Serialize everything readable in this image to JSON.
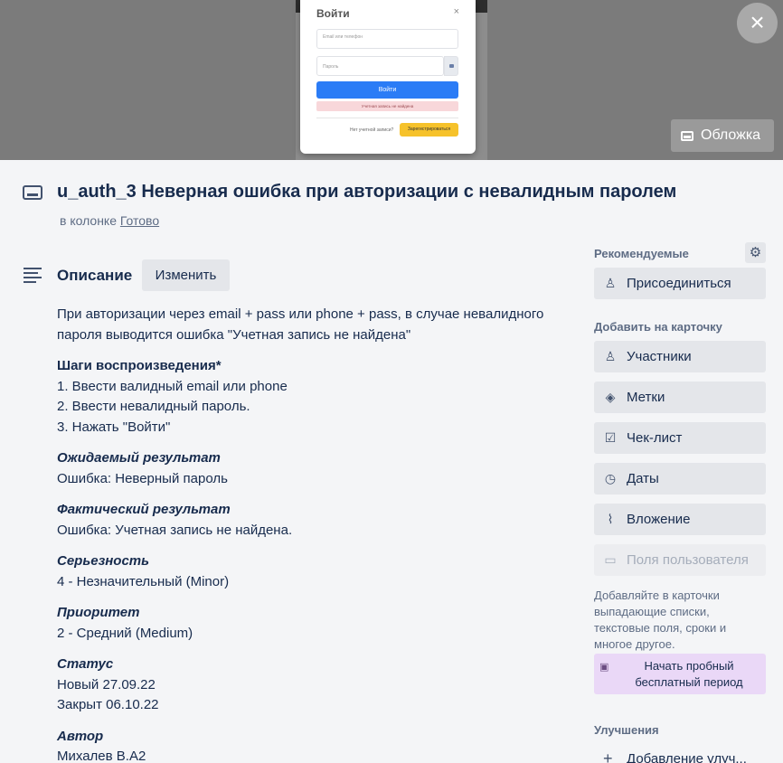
{
  "cover": {
    "modal": {
      "title": "Войти",
      "email_placeholder": "Email или телефон",
      "password_placeholder": "Пароль",
      "login_label": "Войти",
      "error_text": "Учетная запись не найдена",
      "no_account_text": "Нет учетной записи?",
      "register_label": "Зарегистрироваться"
    },
    "close_label": "×",
    "cover_button_label": "Обложка"
  },
  "card": {
    "title": "u_auth_3 Неверная ошибка при авторизации с невалидным паролем",
    "in_list_prefix": "в колонке",
    "list_name": "Готово"
  },
  "description": {
    "title": "Описание",
    "edit_label": "Изменить",
    "intro_line1": "При авторизации через email + pass или phone + pass, в случае невалидного",
    "intro_line2": "пароля выводится ошибка \"Учетная запись не найдена\"",
    "steps_heading": "Шаги воспроизведения*",
    "steps": [
      "1. Ввести валидный email или phone",
      "2. Ввести невалидный пароль.",
      "3. Нажать \"Войти\""
    ],
    "expected_heading": "Ожидаемый результат",
    "expected_text": "Ошибка: Неверный пароль",
    "actual_heading": "Фактический результат",
    "actual_text": "Ошибка: Учетная запись не найдена.",
    "severity_heading": "Серьезность",
    "severity_text": "4 - Незначительный (Minor)",
    "priority_heading": "Приоритет",
    "priority_text": "2 - Средний (Medium)",
    "status_heading": "Статус",
    "status_lines": [
      "Новый 27.09.22",
      "Закрыт 06.10.22"
    ],
    "author_heading": "Автор",
    "author_text": "Михалев В.А2"
  },
  "sidebar": {
    "recommended_label": "Рекомендуемые",
    "join_label": "Присоединиться",
    "add_to_card_label": "Добавить на карточку",
    "members_label": "Участники",
    "labels_label": "Метки",
    "checklist_label": "Чек-лист",
    "dates_label": "Даты",
    "attachment_label": "Вложение",
    "custom_fields_label": "Поля пользователя",
    "promo_text": "Добавляйте в карточки выпадающие списки, текстовые поля, сроки и многое другое.",
    "trial_label": "Начать пробный бесплатный период",
    "improvements_label": "Улучшения",
    "add_improvement_label": "Добавление улуч..."
  },
  "icons": {
    "close": "close-icon",
    "cover": "card-cover-icon",
    "card": "card-icon",
    "description": "description-lines-icon",
    "gear": "gear-icon",
    "person": "person-icon",
    "tag": "tag-icon",
    "checklist": "checkbox-icon",
    "clock": "clock-icon",
    "paperclip": "paperclip-icon",
    "custom_fields": "custom-fields-icon",
    "briefcase": "briefcase-icon",
    "plus": "plus-icon"
  }
}
